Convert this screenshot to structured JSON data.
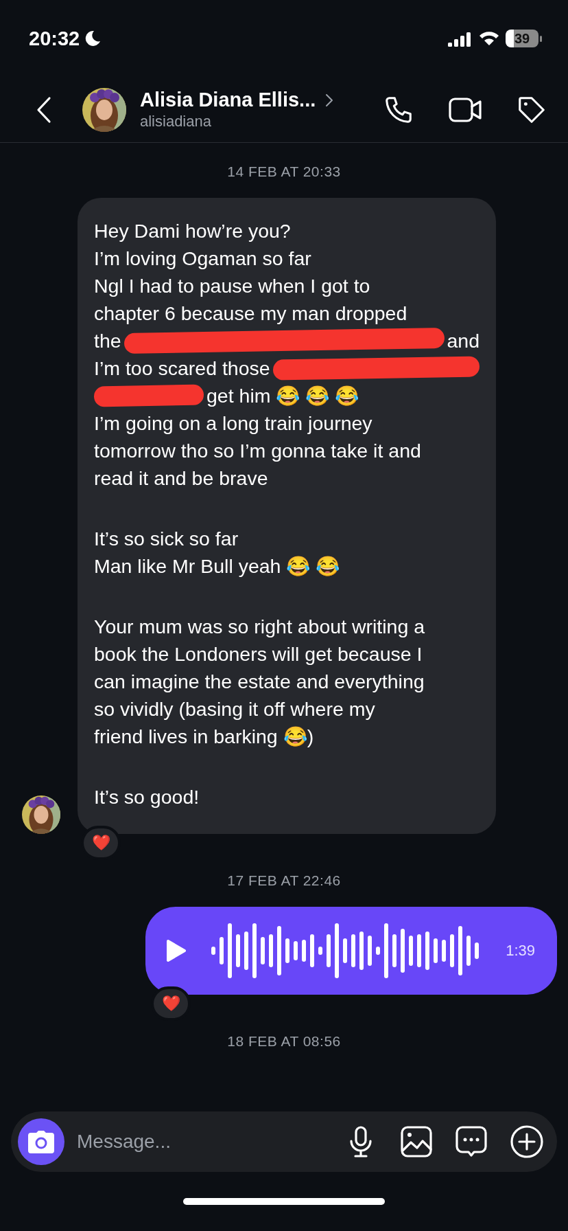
{
  "status_bar": {
    "time": "20:32",
    "battery": "39"
  },
  "header": {
    "name": "Alisia Diana Ellis...",
    "username": "alisiadiana"
  },
  "messages": [
    {
      "kind": "timestamp",
      "text": "14 FEB AT 20:33"
    },
    {
      "kind": "text",
      "reaction": "❤️",
      "lines": [
        {
          "kind": "text",
          "text": "Hey Dami how’re you?"
        },
        {
          "kind": "text",
          "text": "I’m loving Ogaman so far"
        },
        {
          "kind": "text",
          "text": "Ngl I had to pause when I got to"
        },
        {
          "kind": "text",
          "text": "chapter 6 because my man dropped"
        },
        {
          "kind": "mixed",
          "parts": [
            {
              "kind": "text",
              "text": "the"
            },
            {
              "kind": "redaction"
            },
            {
              "kind": "text",
              "text": "and"
            }
          ]
        },
        {
          "kind": "mixed",
          "parts": [
            {
              "kind": "text",
              "text": "I’m too scared those"
            },
            {
              "kind": "redaction"
            }
          ]
        },
        {
          "kind": "mixed",
          "parts": [
            {
              "kind": "redaction"
            },
            {
              "kind": "text",
              "text": "get him 😂 😂 😂"
            }
          ]
        },
        {
          "kind": "text",
          "text": "I’m going on a long train journey"
        },
        {
          "kind": "text",
          "text": "tomorrow tho so I’m gonna take it and"
        },
        {
          "kind": "text",
          "text": "read it and be brave"
        },
        {
          "kind": "gap"
        },
        {
          "kind": "text",
          "text": "It’s so sick so far"
        },
        {
          "kind": "text",
          "text": "Man like Mr Bull yeah 😂 😂"
        },
        {
          "kind": "gap"
        },
        {
          "kind": "text",
          "text": "Your mum was so right about writing a"
        },
        {
          "kind": "text",
          "text": "book the Londoners will get because I"
        },
        {
          "kind": "text",
          "text": "can imagine the estate and everything"
        },
        {
          "kind": "text",
          "text": "so vividly (basing it off where my"
        },
        {
          "kind": "text",
          "text": "friend lives in barking 😂)"
        },
        {
          "kind": "gap"
        },
        {
          "kind": "text",
          "text": "It’s so good!"
        }
      ]
    },
    {
      "kind": "timestamp",
      "text": "17 FEB AT 22:46"
    },
    {
      "kind": "voice",
      "duration": "1:39",
      "reaction": "❤️"
    },
    {
      "kind": "timestamp",
      "text": "18 FEB AT 08:56"
    }
  ],
  "composer": {
    "placeholder": "Message..."
  }
}
